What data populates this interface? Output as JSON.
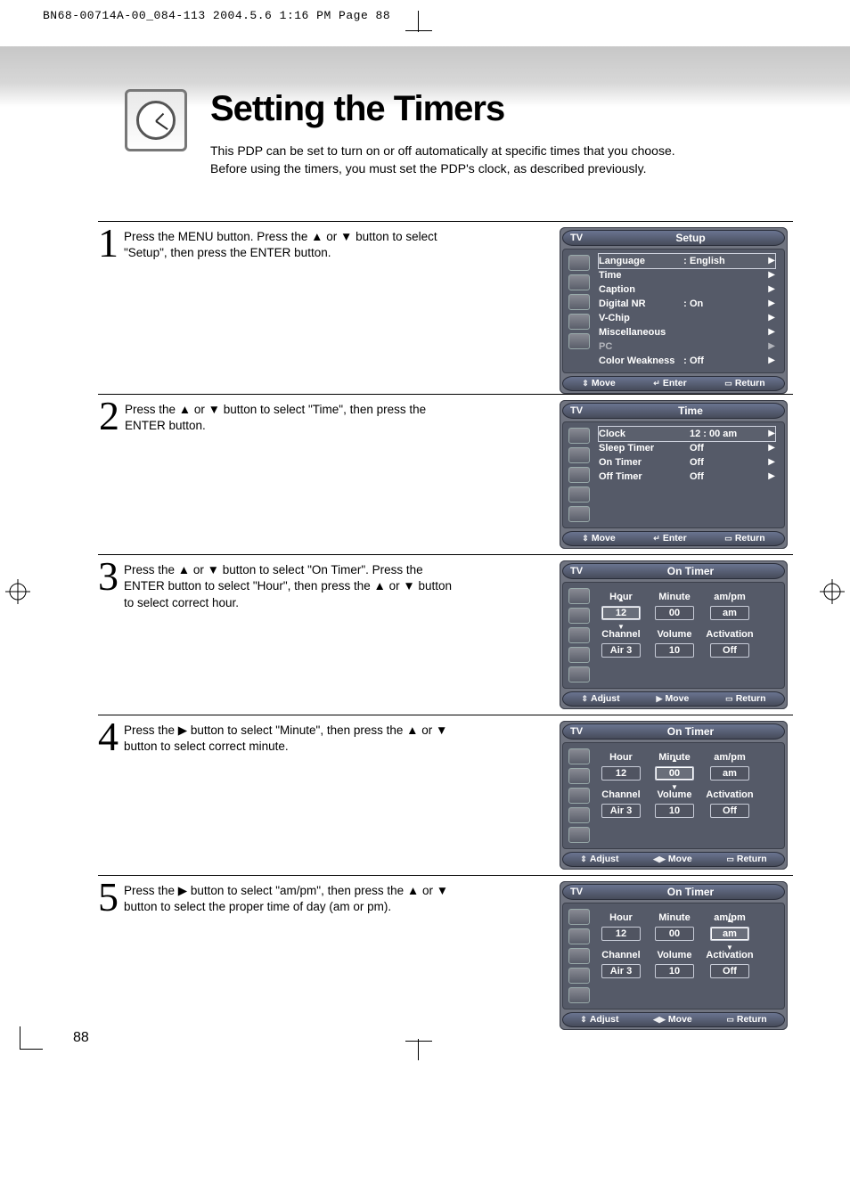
{
  "print_header": "BN68-00714A-00_084-113  2004.5.6  1:16 PM  Page 88",
  "page_number": "88",
  "title": "Setting the Timers",
  "intro": "This PDP can be set to turn on or off automatically at specific times that you choose. Before using the timers, you must set the PDP's clock, as described previously.",
  "steps": [
    {
      "n": "1",
      "text": "Press the MENU button. Press the ▲ or ▼ button to select \"Setup\", then press the ENTER button."
    },
    {
      "n": "2",
      "text": "Press the ▲ or ▼ button to select \"Time\", then press the ENTER button."
    },
    {
      "n": "3",
      "text": "Press the ▲ or ▼ button to select \"On Timer\". Press the ENTER button to select \"Hour\", then press the ▲ or ▼ button to select correct hour."
    },
    {
      "n": "4",
      "text": "Press the ▶ button to select \"Minute\", then press the ▲ or ▼ button to select correct minute."
    },
    {
      "n": "5",
      "text": "Press the ▶ button to select \"am/pm\", then press the ▲ or ▼ button to select the proper time of day (am or pm)."
    }
  ],
  "osd_tv_label": "TV",
  "osd_footer_items": {
    "move": "Move",
    "enter": "Enter",
    "return": "Return",
    "adjust": "Adjust"
  },
  "osd1": {
    "title": "Setup",
    "items": [
      {
        "label": "Language",
        "sep": ":",
        "value": "English",
        "highlight": true
      },
      {
        "label": "Time",
        "sep": "",
        "value": ""
      },
      {
        "label": "Caption",
        "sep": "",
        "value": ""
      },
      {
        "label": "Digital NR",
        "sep": ":",
        "value": "On"
      },
      {
        "label": "V-Chip",
        "sep": "",
        "value": ""
      },
      {
        "label": "Miscellaneous",
        "sep": "",
        "value": ""
      },
      {
        "label": "PC",
        "sep": "",
        "value": "",
        "dim": true
      },
      {
        "label": "Color Weakness",
        "sep": ":",
        "value": "Off"
      }
    ]
  },
  "osd2": {
    "title": "Time",
    "items": [
      {
        "label": "Clock",
        "value": "12 : 00 am",
        "highlight": true
      },
      {
        "label": "Sleep Timer",
        "value": "Off"
      },
      {
        "label": "On Timer",
        "value": "Off"
      },
      {
        "label": "Off Timer",
        "value": "Off"
      }
    ]
  },
  "timer_common": {
    "title": "On Timer",
    "head_row": [
      "Hour",
      "Minute",
      "am/pm"
    ],
    "head_row2": [
      "Channel",
      "Volume",
      "Activation"
    ],
    "vals": [
      "12",
      "00",
      "am"
    ],
    "vals2": [
      "Air   3",
      "10",
      "Off"
    ]
  },
  "osd3_selected_col": 0,
  "osd4_selected_col": 1,
  "osd5_selected_col": 2,
  "osd3_footer_move_glyph": "▶",
  "osd4_footer_move_glyph": "◀▶",
  "osd5_footer_move_glyph": "◀▶"
}
